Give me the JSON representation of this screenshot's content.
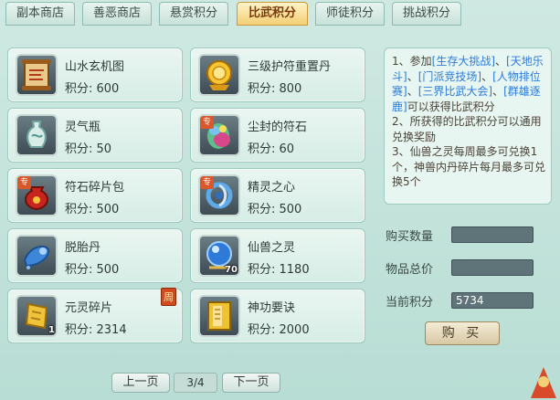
{
  "tabs": [
    {
      "label": "副本商店",
      "active": false
    },
    {
      "label": "善恶商店",
      "active": false
    },
    {
      "label": "悬赏积分",
      "active": false
    },
    {
      "label": "比武积分",
      "active": true
    },
    {
      "label": "师徒积分",
      "active": false
    },
    {
      "label": "挑战积分",
      "active": false
    }
  ],
  "items": [
    {
      "name": "山水玄机图",
      "price": "积分: 600",
      "icon": "scroll-icon"
    },
    {
      "name": "三级护符重置丹",
      "price": "积分: 800",
      "icon": "golden-talisman-pill-icon"
    },
    {
      "name": "灵气瓶",
      "price": "积分: 50",
      "icon": "vase-icon"
    },
    {
      "name": "尘封的符石",
      "price": "积分: 60",
      "icon": "gem-stone-icon",
      "tag": "专"
    },
    {
      "name": "符石碎片包",
      "price": "积分: 500",
      "icon": "red-pouch-icon",
      "tag": "专"
    },
    {
      "name": "精灵之心",
      "price": "积分: 500",
      "icon": "spirit-heart-icon",
      "tag": "专"
    },
    {
      "name": "脱胎丹",
      "price": "积分: 500",
      "icon": "blue-pill-icon"
    },
    {
      "name": "仙兽之灵",
      "price": "积分: 1180",
      "icon": "blue-orb-icon",
      "qty": "70"
    },
    {
      "name": "元灵碎片",
      "price": "积分: 2314",
      "icon": "yellow-shard-icon",
      "qty": "1",
      "badge": "周"
    },
    {
      "name": "神功要诀",
      "price": "积分: 2000",
      "icon": "yellow-book-icon"
    }
  ],
  "description": {
    "p1_a": "1、参加",
    "p1_links": [
      "[生存大挑战]",
      "[天地乐斗]",
      "[门派竞技场]",
      "[人物排位赛]",
      "[三界比武大会]",
      "[群雄逐鹿]"
    ],
    "sep": "、",
    "p1_b": "可以获得比武积分",
    "p2": "2、所获得的比武积分可以通用兑换奖励",
    "p3": "3、仙兽之灵每周最多可兑换1个，神兽内丹碎片每月最多可兑换5个"
  },
  "stats": {
    "buy_qty_label": "购买数量",
    "buy_qty_value": "",
    "total_label": "物品总价",
    "total_value": "",
    "current_label": "当前积分",
    "current_value": "5734"
  },
  "buy_label": "购 买",
  "pagination": {
    "prev": "上一页",
    "page": "3/4",
    "next": "下一页"
  },
  "colors": {
    "accent": "#f3cf75",
    "link": "#2d7bd6",
    "panel": "#cfe9e2"
  }
}
